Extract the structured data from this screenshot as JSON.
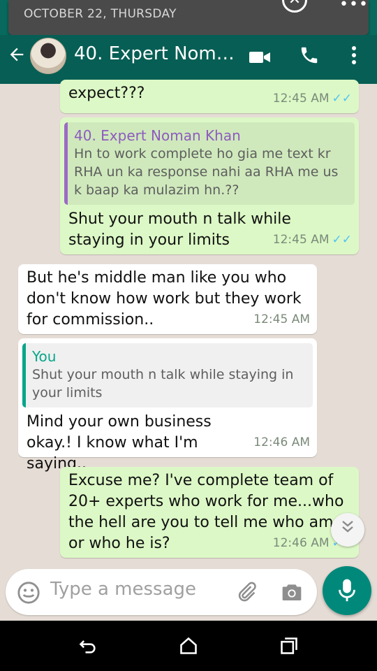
{
  "notification": {
    "date": "OCTOBER 22, THURSDAY"
  },
  "header": {
    "title": "40. Expert Noma..."
  },
  "messages": [
    {
      "text": "expect???",
      "time": "12:45 AM"
    },
    {
      "quote_author": "40. Expert Noman Khan",
      "quote_text": "Hn to work complete ho gia me text kr RHA un ka response nahi aa RHA me us k baap ka mulazim hn.??",
      "text": "Shut your mouth n talk while staying in your limits",
      "time": "12:45 AM"
    },
    {
      "text": "But he's middle man like you who don't know how work but they work for commission..",
      "time": "12:45 AM"
    },
    {
      "quote_author": "You",
      "quote_text": "Shut your mouth n talk while staying in your limits",
      "text": "Mind your own business okay.! I know what I'm saying..",
      "time": "12:46 AM"
    },
    {
      "text": "Excuse me? I've complete team of 20+ experts who work for me...who the hell are you to tell me who am i or who he is?",
      "time": "12:46 AM"
    }
  ],
  "input": {
    "placeholder": "Type a message"
  },
  "colors": {
    "header": "#075e54",
    "outgoing": "#dcf8c6",
    "incoming": "#ffffff",
    "mic": "#00897b",
    "read_ticks": "#4fc3f7"
  },
  "icons": [
    "back-arrow-icon",
    "video-call-icon",
    "phone-icon",
    "more-vert-icon",
    "emoji-icon",
    "attach-icon",
    "camera-icon",
    "mic-icon",
    "scroll-down-icon",
    "nav-back-icon",
    "nav-home-icon",
    "nav-recents-icon"
  ]
}
